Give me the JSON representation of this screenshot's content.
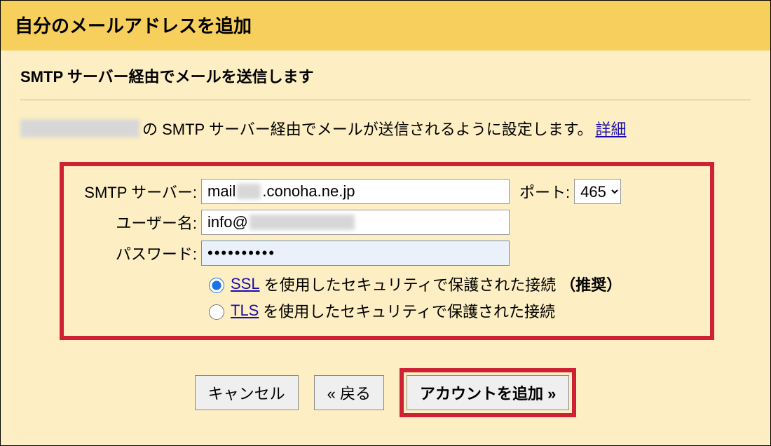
{
  "header": {
    "title": "自分のメールアドレスを追加"
  },
  "subtitle": "SMTP サーバー経由でメールを送信します",
  "desc": {
    "text": "の SMTP サーバー経由でメールが送信されるように設定します。",
    "link": "詳細"
  },
  "form": {
    "server_label": "SMTP サーバー:",
    "server_prefix": "mail",
    "server_suffix": ".conoha.ne.jp",
    "port_label": "ポート:",
    "port_value": "465",
    "user_label": "ユーザー名:",
    "user_prefix": "info@",
    "pass_label": "パスワード:",
    "pass_value": "••••••••••",
    "ssl_link": "SSL",
    "ssl_text": " を使用したセキュリティで保護された接続",
    "ssl_rec": "（推奨）",
    "tls_link": "TLS",
    "tls_text": " を使用したセキュリティで保護された接続"
  },
  "buttons": {
    "cancel": "キャンセル",
    "back": "« 戻る",
    "add": "アカウントを追加 »"
  }
}
